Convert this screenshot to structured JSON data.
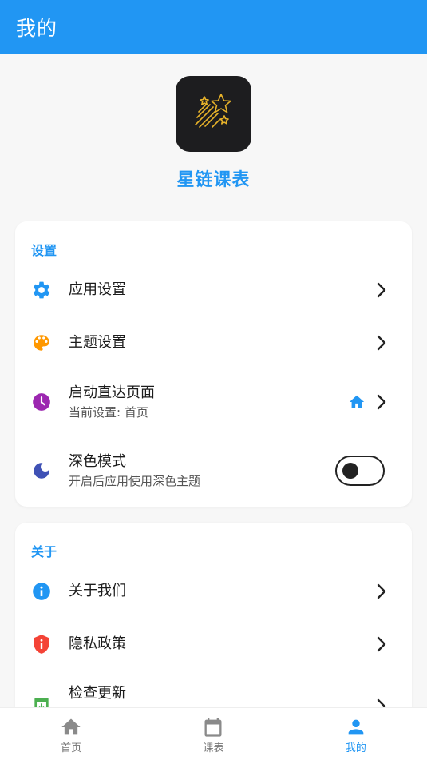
{
  "appbar": {
    "title": "我的"
  },
  "app": {
    "name": "星链课表"
  },
  "settings": {
    "header": "设置",
    "items": [
      {
        "label": "应用设置",
        "icon": "gear-icon"
      },
      {
        "label": "主题设置",
        "icon": "palette-icon"
      },
      {
        "label": "启动直达页面",
        "sub": "当前设置: 首页",
        "icon": "clock-icon"
      },
      {
        "label": "深色模式",
        "sub": "开启后应用使用深色主题",
        "icon": "moon-icon",
        "toggle": false
      }
    ]
  },
  "about": {
    "header": "关于",
    "items": [
      {
        "label": "关于我们",
        "icon": "info-icon"
      },
      {
        "label": "隐私政策",
        "icon": "shield-icon"
      },
      {
        "label": "检查更新",
        "icon": "update-icon"
      }
    ]
  },
  "nav": [
    {
      "label": "首页",
      "icon": "home-icon",
      "active": false
    },
    {
      "label": "课表",
      "icon": "calendar-icon",
      "active": false
    },
    {
      "label": "我的",
      "icon": "person-icon",
      "active": true
    }
  ],
  "colors": {
    "primary": "#2196f3",
    "palette": "#ff9800",
    "clock": "#9c27b0",
    "moon": "#3f51b5",
    "shield": "#f44336",
    "update": "#4caf50"
  }
}
